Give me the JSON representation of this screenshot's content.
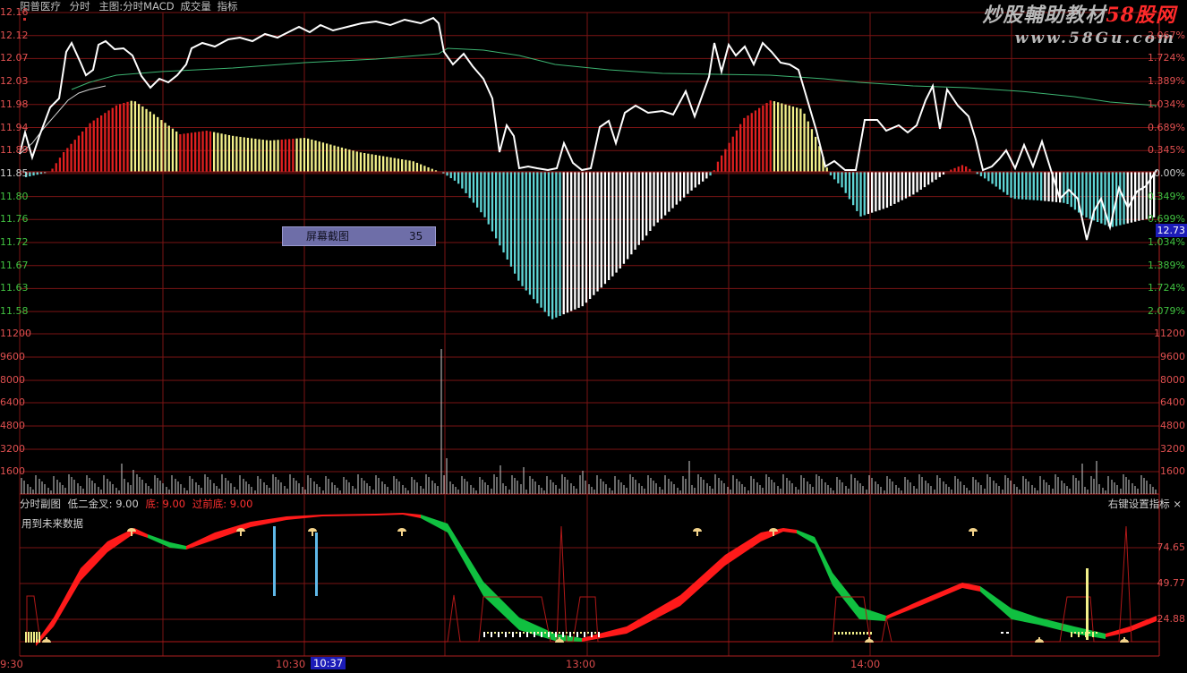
{
  "header": {
    "stock_name": "阳普医疗",
    "mode": "分时",
    "main_chart": "主图:分时MACD",
    "volume": "成交量",
    "indicator": "指标"
  },
  "watermark": {
    "line1_a": "炒股輔助教材",
    "line1_b": "58股网",
    "line2": "www.58Gu.com"
  },
  "price_axis_left": [
    "12.16",
    "12.12",
    "12.07",
    "12.03",
    "11.98",
    "11.94",
    "11.89",
    "11.85",
    "11.80",
    "11.76",
    "11.72",
    "11.67",
    "11.63",
    "11.58"
  ],
  "price_axis_right": [
    "2.067%",
    "1.724%",
    "1.389%",
    "1.034%",
    "0.689%",
    "0.345%",
    "0.00%",
    "0.349%",
    "0.699%",
    "1.034%",
    "1.389%",
    "1.724%",
    "2.079%"
  ],
  "current_price": "12.73",
  "volume_axis_left": [
    "11200",
    "9600",
    "8000",
    "6400",
    "4800",
    "3200",
    "1600"
  ],
  "volume_axis_right": [
    "11200",
    "9600",
    "8000",
    "6400",
    "4800",
    "3200",
    "1600"
  ],
  "tooltip": {
    "label": "屏幕截图",
    "value": "35"
  },
  "sub_chart": {
    "title": "分时副图",
    "low_cross_label": "低二金叉:",
    "low_cross_value": "9.00",
    "bottom_label": "底:",
    "bottom_value": "9.00",
    "over_bottom_label": "过前底:",
    "over_bottom_value": "9.00",
    "note": "用到未来数据",
    "right_settings": "右键设置指标 ×",
    "axis": [
      "74.65",
      "49.77",
      "24.88"
    ]
  },
  "time_axis": {
    "t1": "9:30",
    "t2": "10:30",
    "t3": "13:00",
    "t4": "14:00",
    "selected": "10:37"
  },
  "colors": {
    "price_line": "#ffffff",
    "avg_line": "#3cb371",
    "macd_red": "#e02020",
    "macd_yellow": "#f2f08a",
    "macd_cyan": "#5fd5d5",
    "macd_white": "#ffffff",
    "grid": "#7a1414"
  }
}
